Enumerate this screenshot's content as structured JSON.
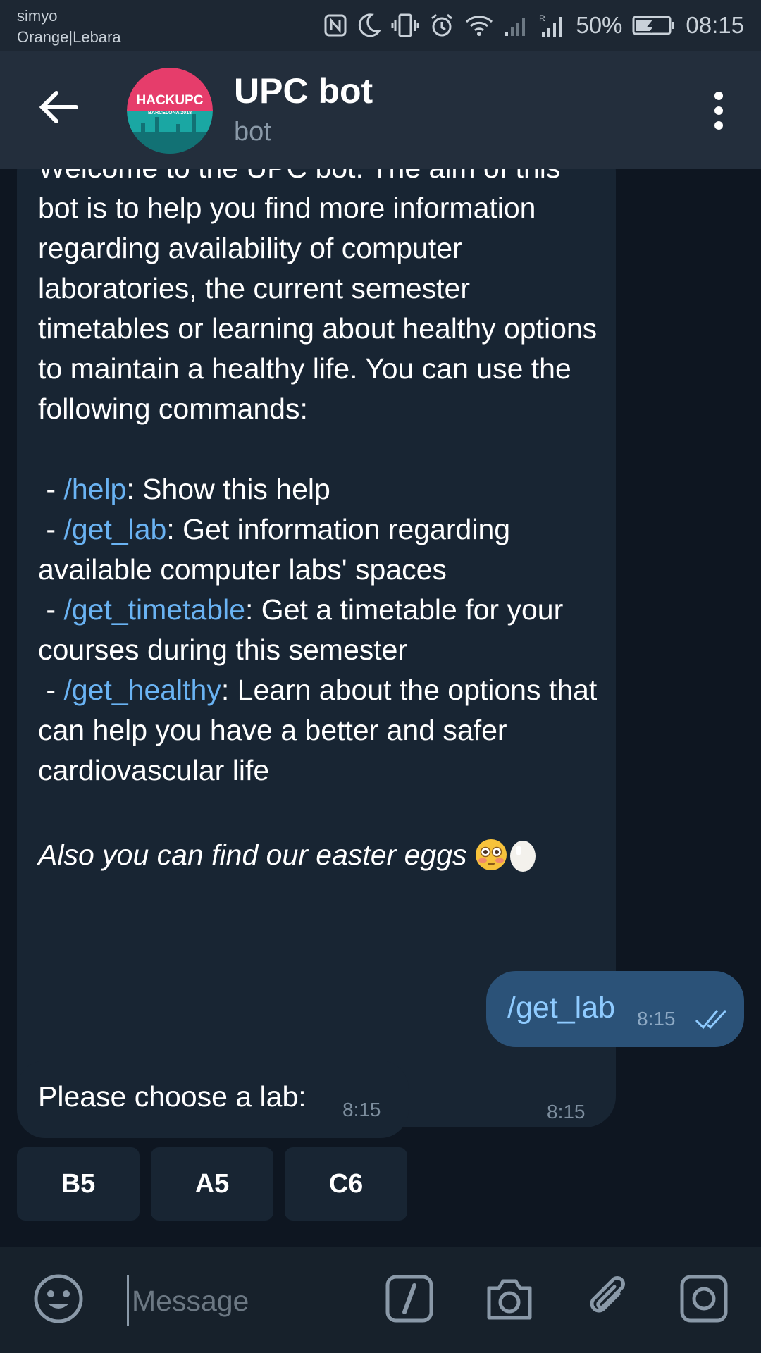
{
  "status_bar": {
    "carrier_line1": "simyo",
    "carrier_line2": "Orange|Lebara",
    "battery_percent": "50%",
    "time": "08:15",
    "icons": [
      "nfc-icon",
      "do-not-disturb-moon-icon",
      "vibrate-icon",
      "alarm-icon",
      "wifi-icon",
      "signal-icon",
      "signal-roaming-icon",
      "battery-charging-icon"
    ]
  },
  "header": {
    "title": "UPC bot",
    "subtitle": "bot",
    "avatar_text": "HACKUPC",
    "avatar_subtext": "BARCELONA 2018",
    "avatar_colors": {
      "top": "#e63d6b",
      "bottom": "#1aa7a3"
    }
  },
  "messages": {
    "welcome": {
      "intro": "Welcome to the UPC bot. The aim of this bot is to help you find more information regarding availability of computer laboratories, the current semester timetables or learning about healthy options to maintain a healthy life. You can use the following commands:",
      "commands": [
        {
          "prefix": " - ",
          "command": "/help",
          "description": ": Show this help"
        },
        {
          "prefix": " - ",
          "command": "/get_lab",
          "description": ": Get information regarding available computer labs' spaces"
        },
        {
          "prefix": " - ",
          "command": "/get_timetable",
          "description": ": Get a timetable for your courses during this semester"
        },
        {
          "prefix": " - ",
          "command": "/get_healthy",
          "description": ": Learn about the options that can help you have a better and safer cardiovascular life"
        }
      ],
      "footer": "Also you can find our easter eggs",
      "time": "8:15"
    },
    "outgoing": {
      "text": "/get_lab",
      "time": "8:15",
      "status": "read"
    },
    "choose": {
      "text": "Please choose a lab:",
      "time": "8:15"
    },
    "keyboard": [
      "B5",
      "A5",
      "C6"
    ]
  },
  "composer": {
    "placeholder": "Message"
  },
  "colors": {
    "accent": "#6ab3f3",
    "header_bg": "#232e3c",
    "chat_bg": "#0e1621",
    "incoming_bubble": "#182533",
    "outgoing_bubble": "#2b5278"
  }
}
